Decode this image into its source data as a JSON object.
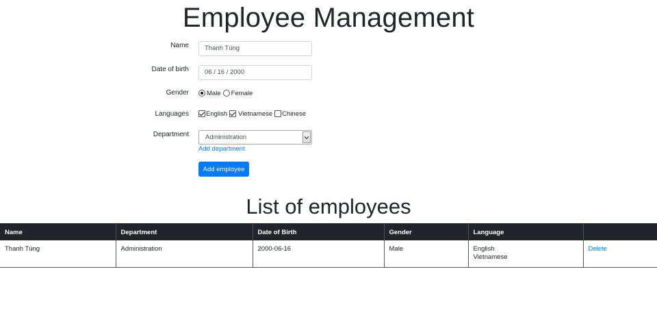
{
  "header": {
    "title": "Employee Management"
  },
  "form": {
    "name_label": "Name",
    "name_value": "Thanh Tùng",
    "dob_label": "Date of birth",
    "dob_value": "06 / 16 / 2000",
    "gender_label": "Gender",
    "gender_options": [
      {
        "label": "Male",
        "checked": true
      },
      {
        "label": "Female",
        "checked": false
      }
    ],
    "languages_label": "Languages",
    "language_options": [
      {
        "label": "English",
        "checked": true
      },
      {
        "label": "Vietnamese",
        "checked": true
      },
      {
        "label": "Chinese",
        "checked": false
      }
    ],
    "department_label": "Department",
    "department_value": "Administration",
    "add_department_link": "Add department",
    "submit_label": "Add employee"
  },
  "list": {
    "title": "List of employees",
    "columns": [
      "Name",
      "Department",
      "Date of Birth",
      "Gender",
      "Language",
      ""
    ],
    "rows": [
      {
        "name": "Thanh Tùng",
        "department": "Administration",
        "dob": "2000-06-16",
        "gender": "Male",
        "languages": [
          "English",
          "Vietnamese"
        ],
        "action": "Delete"
      }
    ]
  },
  "colors": {
    "accent": "#007bff",
    "table_header_bg": "#212529",
    "text": "#212529"
  }
}
